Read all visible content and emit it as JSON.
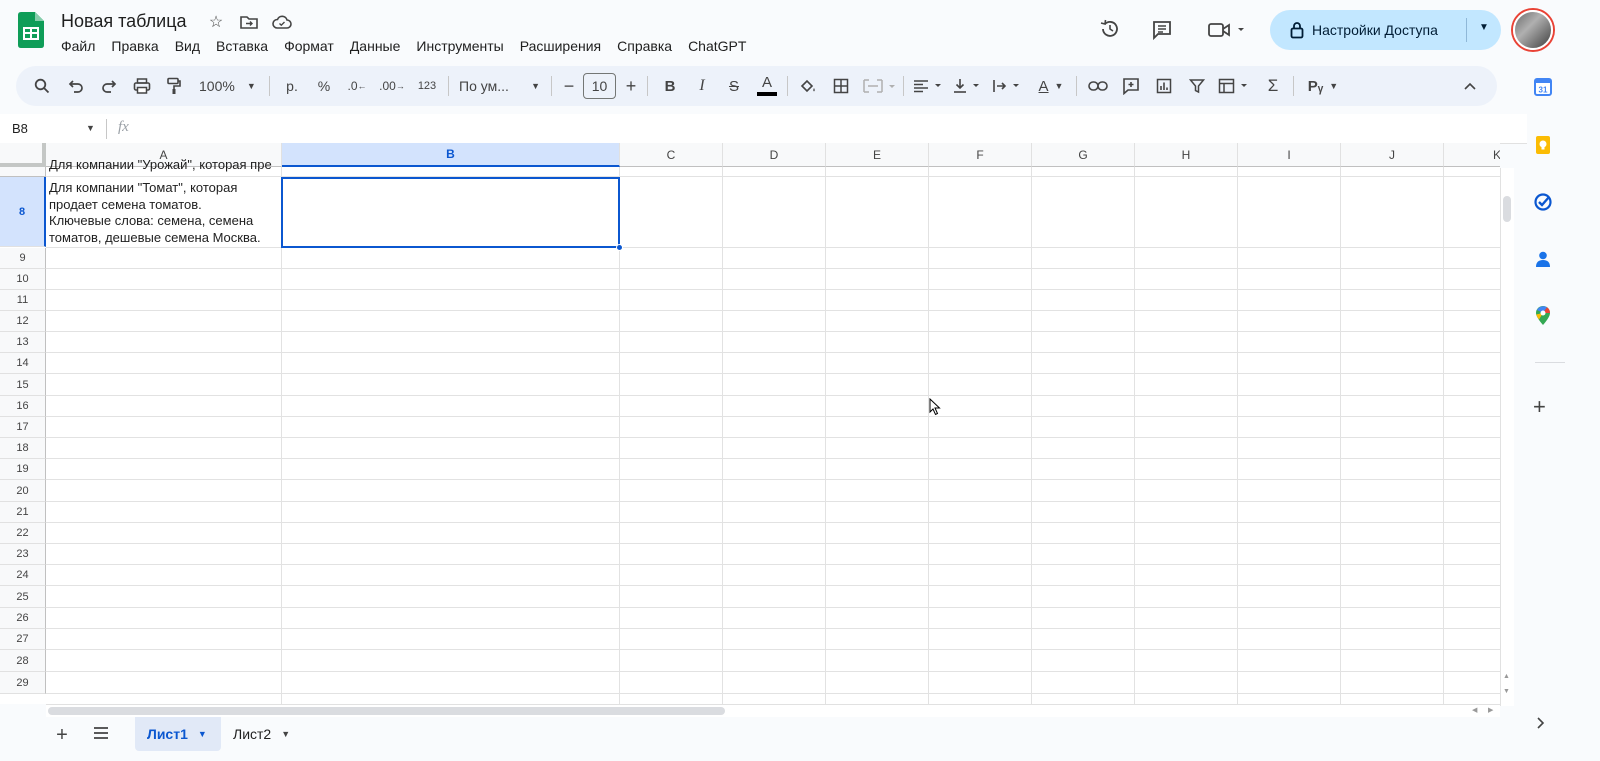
{
  "app": {
    "title": "Новая таблица",
    "menu": [
      "Файл",
      "Правка",
      "Вид",
      "Вставка",
      "Формат",
      "Данные",
      "Инструменты",
      "Расширения",
      "Справка",
      "ChatGPT"
    ],
    "share_label": "Настройки Доступа"
  },
  "toolbar": {
    "zoom": "100%",
    "currency": "р.",
    "percent": "%",
    "dec_decrease": ".0",
    "dec_increase": ".00",
    "number_format": "123",
    "font": "По ум...",
    "font_size": "10",
    "bold": "B",
    "italic": "I",
    "strike": "S",
    "text_color": "A"
  },
  "formula_bar": {
    "cell_ref": "B8",
    "fx": "fx",
    "content": ""
  },
  "grid": {
    "columns": [
      "A",
      "B",
      "C",
      "D",
      "E",
      "F",
      "G",
      "H",
      "I",
      "J",
      "K"
    ],
    "selected_column": "B",
    "partial_row_text": "Для компании \"Урожай\", которая пре",
    "row8": {
      "label": "8",
      "a_lines": [
        "Для компании \"Томат\", которая",
        "продает семена томатов.",
        "Ключевые слова: семена, семена",
        "томатов, дешевые семена Москва."
      ]
    },
    "rows": [
      "9",
      "10",
      "11",
      "12",
      "13",
      "14",
      "15",
      "16",
      "17",
      "18",
      "19",
      "20",
      "21",
      "22",
      "23",
      "24",
      "25",
      "26",
      "27",
      "28",
      "29"
    ]
  },
  "sheets": {
    "tabs": [
      {
        "label": "Лист1",
        "active": true
      },
      {
        "label": "Лист2",
        "active": false
      }
    ]
  },
  "colors": {
    "accent": "#0b57d0",
    "share_bg": "#c2e7ff",
    "toolbar_bg": "#edf2fa",
    "selected_header": "#d3e3fd",
    "sheets_green": "#0f9d58"
  }
}
